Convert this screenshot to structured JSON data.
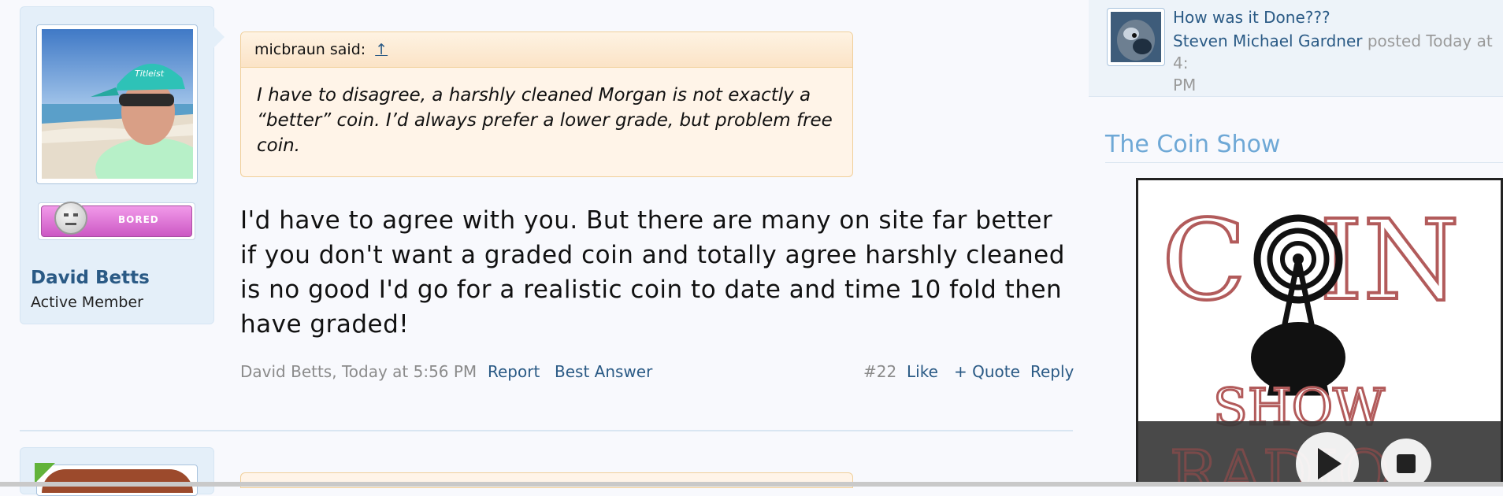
{
  "post": {
    "user": {
      "name": "David Betts",
      "title": "Active Member",
      "mood": "BORED"
    },
    "quote": {
      "author": "micbraun said:",
      "jump_icon": "↑",
      "text": "I have to disagree, a harshly cleaned Morgan is not exactly a “better” coin. I’d always prefer a lower grade, but problem free coin."
    },
    "message": "I'd have to agree with you. But there are many on site far better if you don't want a graded coin and totally agree harshly cleaned is no good I'd go for a realistic coin to date and time 10 fold then have graded!",
    "footer": {
      "meta": "David Betts, Today at 5:56 PM",
      "report": "Report",
      "best_answer": "Best Answer",
      "post_number": "#22",
      "like": "Like",
      "quote": "+ Quote",
      "reply": "Reply"
    }
  },
  "sidebar": {
    "activity": {
      "title": "How was it Done???",
      "user": "Steven Michael Gardner",
      "action": "posted Today at 4:",
      "action_wrap": "PM"
    },
    "coin_show": {
      "title": "The Coin Show"
    }
  },
  "colors": {
    "link": "#2a5a85",
    "quote_bg": "#fff4e8",
    "quote_border": "#f0cf9a",
    "user_panel": "#e4eff9",
    "mood_pink": "#e07ad8",
    "section_title": "#6ea8d6"
  }
}
